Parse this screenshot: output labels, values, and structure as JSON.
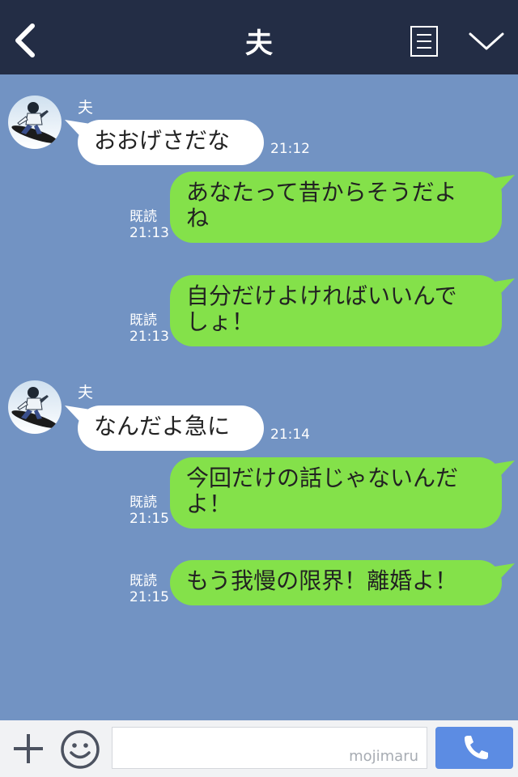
{
  "header": {
    "title": "夫"
  },
  "messages": [
    {
      "sender": "夫",
      "text": "おおげさだな",
      "time": "21:12"
    },
    {
      "read": "既読",
      "time": "21:13",
      "line1": "あなたって昔からそうだよ",
      "line2": "ね"
    },
    {
      "read": "既読",
      "time": "21:13",
      "line1": "自分だけよければいいんで",
      "line2": "しょ！"
    },
    {
      "sender": "夫",
      "text": "なんだよ急に",
      "time": "21:14"
    },
    {
      "read": "既読",
      "time": "21:15",
      "line1": "今回だけの話じゃないんだ",
      "line2": "よ！"
    },
    {
      "read": "既読",
      "time": "21:15",
      "line1": "もう我慢の限界！離婚よ！"
    }
  ],
  "input": {
    "watermark": "mojimaru"
  },
  "icons": {
    "back": "chevron-left-icon",
    "menu": "menu-list-icon",
    "collapse": "chevron-down-icon",
    "add": "plus-icon",
    "emoji": "smiley-icon",
    "call": "phone-icon"
  },
  "colors": {
    "header": "#232d45",
    "chat_background": "#7293c3",
    "incoming_bubble": "#ffffff",
    "outgoing_bubble": "#84e14a",
    "send_button": "#5c8ce3"
  }
}
